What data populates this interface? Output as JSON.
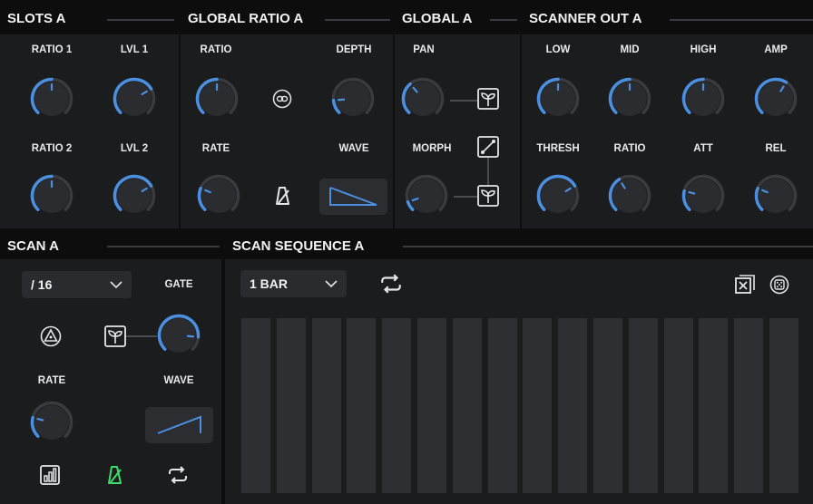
{
  "slots": {
    "title": "SLOTS A",
    "knobs": [
      {
        "label": "RATIO 1",
        "value": 0.5
      },
      {
        "label": "LVL 1",
        "value": 0.72
      },
      {
        "label": "RATIO 2",
        "value": 0.5
      },
      {
        "label": "LVL 2",
        "value": 0.72
      }
    ]
  },
  "global_ratio": {
    "title": "GLOBAL RATIO A",
    "ratio": {
      "label": "RATIO",
      "value": 0.5
    },
    "depth": {
      "label": "DEPTH",
      "value": 0.15
    },
    "rate": {
      "label": "RATE",
      "value": 0.25
    },
    "wave": {
      "label": "WAVE"
    },
    "link_icon": "link-icon",
    "metronome_icon": "metronome-icon"
  },
  "global": {
    "title": "GLOBAL A",
    "pan": {
      "label": "PAN",
      "value": 0.35
    },
    "morph": {
      "label": "MORPH",
      "value": 0.1
    },
    "sprout_icon": "sprout-icon",
    "curve_icon": "curve-icon"
  },
  "scanner_out": {
    "title": "SCANNER OUT A",
    "knobs": [
      {
        "label": "LOW",
        "value": 0.5
      },
      {
        "label": "MID",
        "value": 0.5
      },
      {
        "label": "HIGH",
        "value": 0.5
      },
      {
        "label": "AMP",
        "value": 0.62
      },
      {
        "label": "THRESH",
        "value": 0.72
      },
      {
        "label": "RATIO",
        "value": 0.38
      },
      {
        "label": "ATT",
        "value": 0.22
      },
      {
        "label": "REL",
        "value": 0.25
      }
    ]
  },
  "scan": {
    "title": "SCAN A",
    "division": "/ 16",
    "gate": {
      "label": "GATE",
      "value": 0.85
    },
    "rate": {
      "label": "RATE",
      "value": 0.22
    },
    "wave": {
      "label": "WAVE"
    },
    "accent_green": "#3ddc6a"
  },
  "scan_sequence": {
    "title": "SCAN SEQUENCE A",
    "length": "1 BAR",
    "steps": 16
  },
  "colors": {
    "accent": "#4a8fe0",
    "track": "#3a3b3e",
    "knob": "#2b2c2f"
  }
}
